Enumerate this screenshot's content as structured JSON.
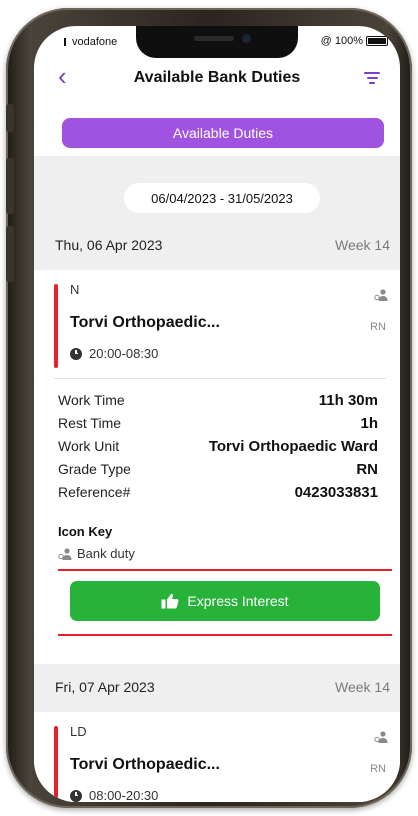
{
  "status_bar": {
    "carrier": "vodafone",
    "battery": "@ 100%"
  },
  "header": {
    "title": "Available Bank Duties",
    "back_icon": "chevron-left-icon",
    "filter_icon": "filter-icon"
  },
  "tab": {
    "label": "Available Duties",
    "color": "#a052e0"
  },
  "date_range": "06/04/2023 - 31/05/2023",
  "days": [
    {
      "date": "Thu, 06 Apr 2023",
      "week": "Week 14",
      "duty": {
        "code": "N",
        "ward": "Torvi Orthopaedic...",
        "grade": "RN",
        "time": "20:00-08:30"
      },
      "details": [
        {
          "label": "Work Time",
          "value": "11h 30m"
        },
        {
          "label": "Rest Time",
          "value": "1h"
        },
        {
          "label": "Work Unit",
          "value": "Torvi Orthopaedic Ward"
        },
        {
          "label": "Grade Type",
          "value": "RN"
        },
        {
          "label": "Reference#",
          "value": "0423033831"
        }
      ],
      "icon_key": {
        "title": "Icon Key",
        "items": [
          {
            "icon": "bank-duty-icon",
            "label": "Bank duty"
          }
        ]
      },
      "action": {
        "label": "Express Interest",
        "icon": "thumbs-up-icon",
        "color": "#27b33a"
      }
    },
    {
      "date": "Fri, 07 Apr 2023",
      "week": "Week 14",
      "duty": {
        "code": "LD",
        "ward": "Torvi Orthopaedic...",
        "grade": "RN",
        "time": "08:00-20:30"
      }
    }
  ],
  "colors": {
    "accent": "#7b3fd0",
    "duty_bar": "#e8202e"
  }
}
